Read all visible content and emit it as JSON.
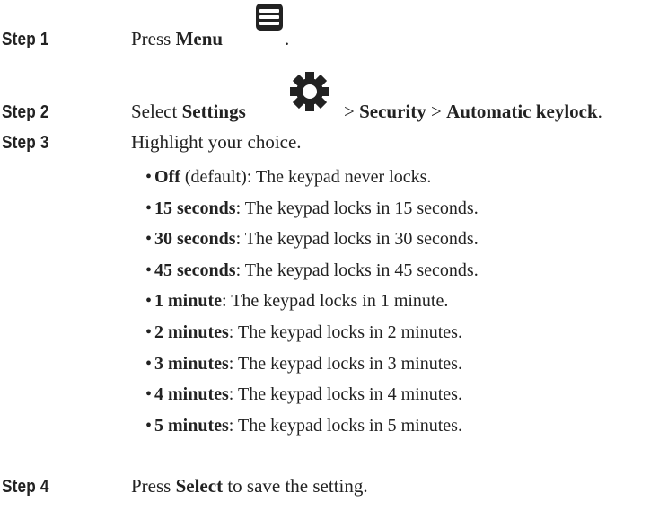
{
  "steps": [
    {
      "label": "Step 1",
      "pre": "Press ",
      "bold1": "Menu",
      "post": "."
    },
    {
      "label": "Step 2",
      "pre": "Select ",
      "bold1": "Settings",
      "sep1": " > ",
      "bold2": "Security",
      "sep2": " > ",
      "bold3": "Automatic keylock",
      "post": "."
    },
    {
      "label": "Step 3",
      "text": "Highlight your choice."
    },
    {
      "label": "Step 4",
      "pre": "Press ",
      "bold1": "Select",
      "post": " to save the setting."
    }
  ],
  "options": [
    {
      "name": "Off",
      "rest": " (default): The keypad never locks."
    },
    {
      "name": "15 seconds",
      "rest": ": The keypad locks in 15 seconds."
    },
    {
      "name": "30 seconds",
      "rest": ": The keypad locks in 30 seconds."
    },
    {
      "name": "45 seconds",
      "rest": ": The keypad locks in 45 seconds."
    },
    {
      "name": "1 minute",
      "rest": ": The keypad locks in 1 minute."
    },
    {
      "name": "2 minutes",
      "rest": ": The keypad locks in 2 minutes."
    },
    {
      "name": "3 minutes",
      "rest": ": The keypad locks in 3 minutes."
    },
    {
      "name": "4 minutes",
      "rest": ": The keypad locks in 4 minutes."
    },
    {
      "name": "5 minutes",
      "rest": ": The keypad locks in 5 minutes."
    }
  ],
  "icons": {
    "menu": "menu-icon",
    "settings": "gear-icon"
  },
  "bullet": "•"
}
